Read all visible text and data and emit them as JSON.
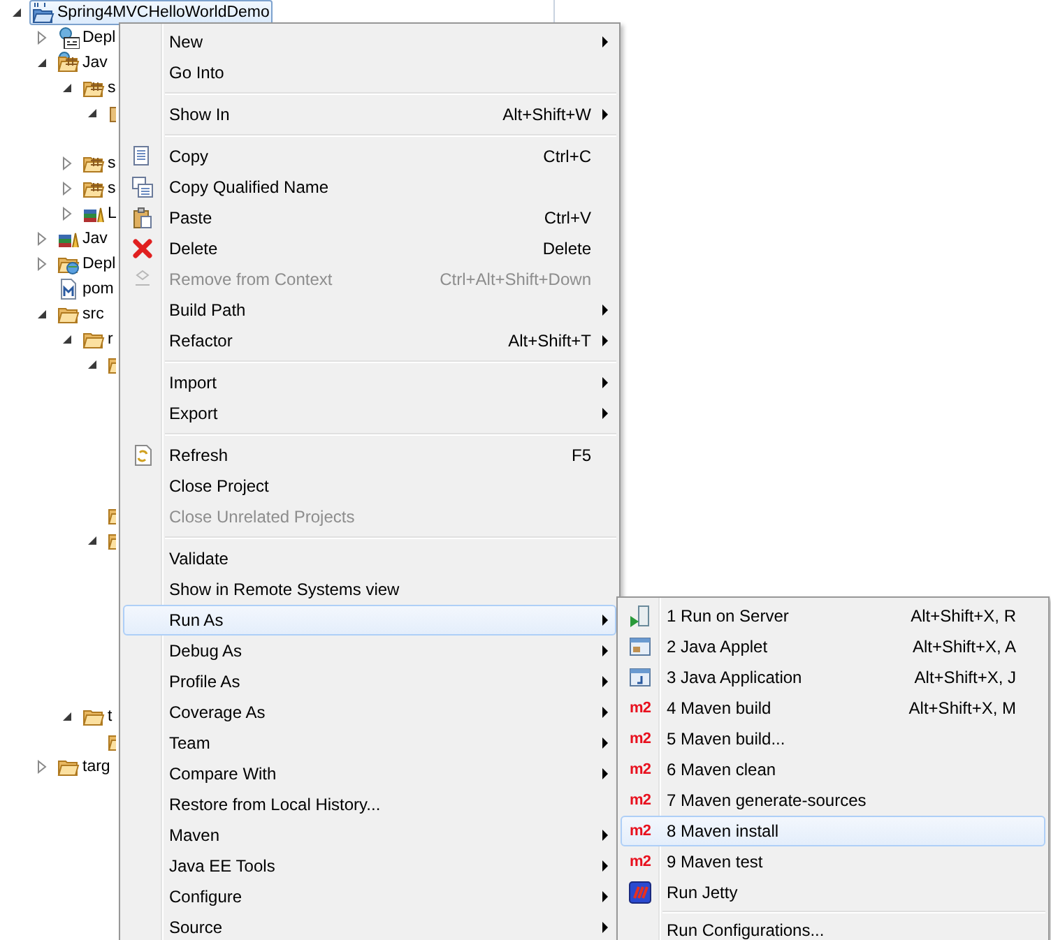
{
  "tree": {
    "items": [
      {
        "label": "Spring4MVCHelloWorldDemo",
        "kind": "project",
        "expanded": true,
        "selected": true,
        "children": [
          {
            "label": "Depl",
            "kind": "deploy",
            "expanded": false,
            "selected": false
          },
          {
            "label": "Jav",
            "kind": "java-resources",
            "expanded": true,
            "selected": false,
            "children": [
              {
                "label": "s",
                "kind": "package-folder",
                "expanded": true,
                "selected": false,
                "children": [
                  {
                    "kind": "package",
                    "expanded": true,
                    "selected": false
                  }
                ]
              },
              {
                "label": "s",
                "kind": "package-folder",
                "expanded": false,
                "selected": false
              },
              {
                "label": "s",
                "kind": "package-folder",
                "expanded": false,
                "selected": false
              },
              {
                "label": "L",
                "kind": "library",
                "expanded": false,
                "selected": false
              }
            ]
          },
          {
            "label": "Jav",
            "kind": "library",
            "expanded": false,
            "selected": false
          },
          {
            "label": "Depl",
            "kind": "web-deploy",
            "expanded": false,
            "selected": false
          },
          {
            "label": "pom",
            "kind": "maven-file",
            "selected": false
          },
          {
            "label": "src",
            "kind": "folder",
            "expanded": true,
            "selected": false,
            "children": [
              {
                "label": "r",
                "kind": "folder",
                "expanded": true,
                "selected": false,
                "children": [
                  {
                    "kind": "folder",
                    "expanded": true,
                    "selected": false
                  },
                  {
                    "kind": "folder",
                    "selected": false
                  },
                  {
                    "kind": "folder",
                    "expanded": true,
                    "selected": false
                  }
                ]
              },
              {
                "label": "t",
                "kind": "folder",
                "expanded": true,
                "selected": false,
                "children": [
                  {
                    "kind": "folder",
                    "selected": false
                  }
                ]
              }
            ]
          },
          {
            "label": "targ",
            "kind": "folder",
            "expanded": false,
            "selected": false
          }
        ]
      }
    ]
  },
  "context_menu": {
    "items": [
      {
        "kind": "item",
        "label": "New",
        "submenu": true,
        "disabled": false,
        "selected": false
      },
      {
        "kind": "item",
        "label": "Go Into",
        "submenu": false,
        "disabled": false,
        "selected": false
      },
      {
        "kind": "separator"
      },
      {
        "kind": "item",
        "label": "Show In",
        "shortcut": "Alt+Shift+W",
        "submenu": true,
        "disabled": false,
        "selected": false
      },
      {
        "kind": "separator"
      },
      {
        "kind": "item",
        "label": "Copy",
        "shortcut": "Ctrl+C",
        "submenu": false,
        "disabled": false,
        "selected": false
      },
      {
        "kind": "item",
        "label": "Copy Qualified Name",
        "submenu": false,
        "disabled": false,
        "selected": false
      },
      {
        "kind": "item",
        "label": "Paste",
        "shortcut": "Ctrl+V",
        "submenu": false,
        "disabled": false,
        "selected": false
      },
      {
        "kind": "item",
        "label": "Delete",
        "shortcut": "Delete",
        "submenu": false,
        "disabled": false,
        "selected": false
      },
      {
        "kind": "item",
        "label": "Remove from Context",
        "shortcut": "Ctrl+Alt+Shift+Down",
        "submenu": false,
        "disabled": true,
        "selected": false
      },
      {
        "kind": "item",
        "label": "Build Path",
        "submenu": true,
        "disabled": false,
        "selected": false
      },
      {
        "kind": "item",
        "label": "Refactor",
        "shortcut": "Alt+Shift+T",
        "submenu": true,
        "disabled": false,
        "selected": false
      },
      {
        "kind": "separator"
      },
      {
        "kind": "item",
        "label": "Import",
        "submenu": true,
        "disabled": false,
        "selected": false
      },
      {
        "kind": "item",
        "label": "Export",
        "submenu": true,
        "disabled": false,
        "selected": false
      },
      {
        "kind": "separator"
      },
      {
        "kind": "item",
        "label": "Refresh",
        "shortcut": "F5",
        "submenu": false,
        "disabled": false,
        "selected": false
      },
      {
        "kind": "item",
        "label": "Close Project",
        "submenu": false,
        "disabled": false,
        "selected": false
      },
      {
        "kind": "item",
        "label": "Close Unrelated Projects",
        "submenu": false,
        "disabled": true,
        "selected": false
      },
      {
        "kind": "separator"
      },
      {
        "kind": "item",
        "label": "Validate",
        "submenu": false,
        "disabled": false,
        "selected": false
      },
      {
        "kind": "item",
        "label": "Show in Remote Systems view",
        "submenu": false,
        "disabled": false,
        "selected": false
      },
      {
        "kind": "item",
        "label": "Run As",
        "submenu": true,
        "disabled": false,
        "selected": true
      },
      {
        "kind": "item",
        "label": "Debug As",
        "submenu": true,
        "disabled": false,
        "selected": false
      },
      {
        "kind": "item",
        "label": "Profile As",
        "submenu": true,
        "disabled": false,
        "selected": false
      },
      {
        "kind": "item",
        "label": "Coverage As",
        "submenu": true,
        "disabled": false,
        "selected": false
      },
      {
        "kind": "item",
        "label": "Team",
        "submenu": true,
        "disabled": false,
        "selected": false
      },
      {
        "kind": "item",
        "label": "Compare With",
        "submenu": true,
        "disabled": false,
        "selected": false
      },
      {
        "kind": "item",
        "label": "Restore from Local History...",
        "submenu": false,
        "disabled": false,
        "selected": false
      },
      {
        "kind": "item",
        "label": "Maven",
        "submenu": true,
        "disabled": false,
        "selected": false
      },
      {
        "kind": "item",
        "label": "Java EE Tools",
        "submenu": true,
        "disabled": false,
        "selected": false
      },
      {
        "kind": "item",
        "label": "Configure",
        "submenu": true,
        "disabled": false,
        "selected": false
      },
      {
        "kind": "item",
        "label": "Source",
        "submenu": true,
        "disabled": false,
        "selected": false
      }
    ]
  },
  "submenu": {
    "items": [
      {
        "kind": "item",
        "label": "1 Run on Server",
        "shortcut": "Alt+Shift+X, R",
        "selected": false
      },
      {
        "kind": "item",
        "label": "2 Java Applet",
        "shortcut": "Alt+Shift+X, A",
        "selected": false
      },
      {
        "kind": "item",
        "label": "3 Java Application",
        "shortcut": "Alt+Shift+X, J",
        "selected": false
      },
      {
        "kind": "item",
        "label": "4 Maven build",
        "shortcut": "Alt+Shift+X, M",
        "badge": "m2",
        "selected": false
      },
      {
        "kind": "item",
        "label": "5 Maven build...",
        "badge": "m2",
        "selected": false
      },
      {
        "kind": "item",
        "label": "6 Maven clean",
        "badge": "m2",
        "selected": false
      },
      {
        "kind": "item",
        "label": "7 Maven generate-sources",
        "badge": "m2",
        "selected": false
      },
      {
        "kind": "item",
        "label": "8 Maven install",
        "badge": "m2",
        "selected": true
      },
      {
        "kind": "item",
        "label": "9 Maven test",
        "badge": "m2",
        "selected": false
      },
      {
        "kind": "item",
        "label": "Run Jetty",
        "selected": false
      },
      {
        "kind": "separator"
      },
      {
        "kind": "item",
        "label": "Run Configurations...",
        "selected": false
      }
    ]
  }
}
